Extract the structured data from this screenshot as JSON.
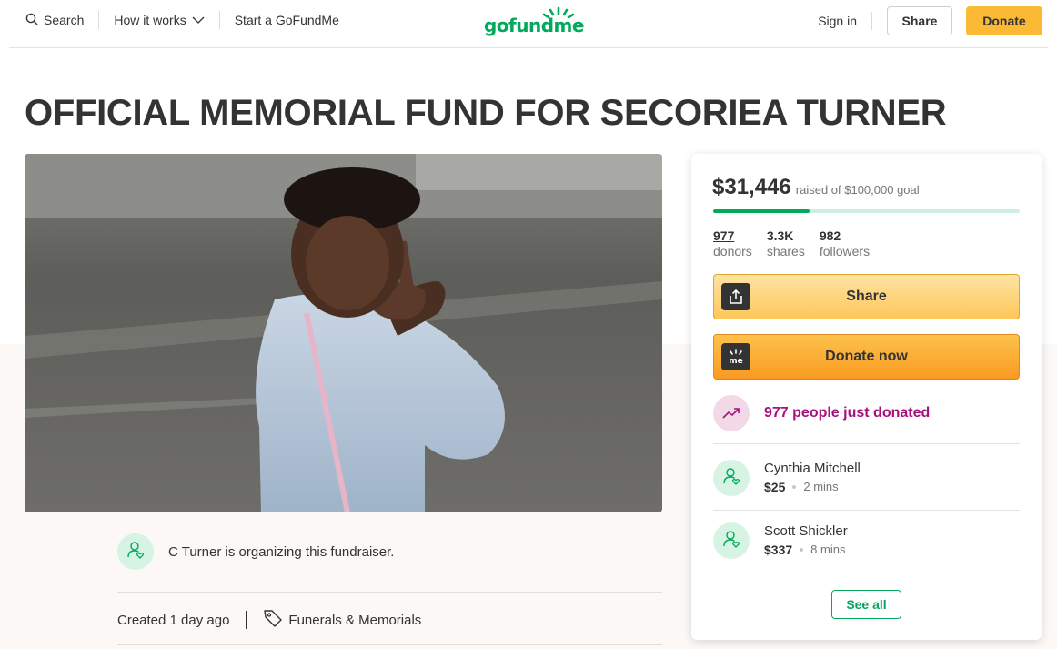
{
  "header": {
    "search_label": "Search",
    "how_it_works_label": "How it works",
    "start_label": "Start a GoFundMe",
    "logo_text": "gofundme",
    "signin_label": "Sign in",
    "share_label": "Share",
    "donate_label": "Donate"
  },
  "campaign": {
    "title": "OFFICIAL MEMORIAL FUND FOR SECORIEA TURNER",
    "organizer_text": "C Turner is organizing this fundraiser.",
    "created_text": "Created 1 day ago",
    "category": "Funerals & Memorials"
  },
  "donation_card": {
    "raised_amount": "$31,446",
    "goal_text": "raised of $100,000 goal",
    "progress_fraction": 0.31446,
    "stats": [
      {
        "value": "977",
        "label": "donors"
      },
      {
        "value": "3.3K",
        "label": "shares"
      },
      {
        "value": "982",
        "label": "followers"
      }
    ],
    "share_button_label": "Share",
    "donate_button_label": "Donate now",
    "donate_icon_text": "me",
    "recent_text": "977 people just donated",
    "donors": [
      {
        "name": "Cynthia Mitchell",
        "amount": "$25",
        "time": "2 mins"
      },
      {
        "name": "Scott Shickler",
        "amount": "$337",
        "time": "8 mins"
      }
    ],
    "see_all_label": "See all"
  },
  "colors": {
    "brand_green": "#02a95c",
    "donate_yellow": "#fbb934",
    "accent_magenta": "#a6117c"
  }
}
